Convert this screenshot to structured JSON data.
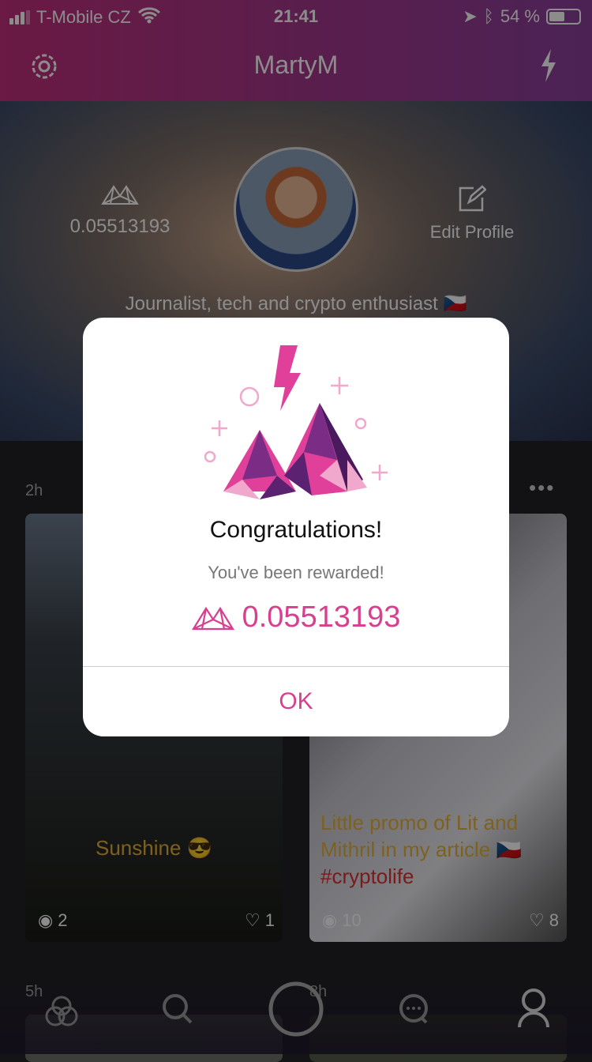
{
  "status_bar": {
    "carrier": "T-Mobile CZ",
    "time": "21:41",
    "battery": "54 %",
    "battery_level": 0.54
  },
  "header": {
    "title": "MartyM",
    "left_icon": "gear-icon",
    "right_icon": "lightning-icon"
  },
  "profile": {
    "balance": "0.05513193",
    "edit_label": "Edit Profile",
    "bio": "Journalist, tech and crypto enthusiast 🇨🇿"
  },
  "feed": {
    "posts": [
      {
        "time": "2h",
        "caption": "Sunshine 😎",
        "views": "2",
        "likes": "1"
      },
      {
        "caption": "Little promo of Lit and Mithril in my article 🇨🇿",
        "tag": "#cryptolife",
        "views": "10",
        "likes": "8"
      },
      {
        "time": "5h"
      },
      {
        "time": "8h"
      }
    ]
  },
  "tabbar": {
    "items": [
      "circles",
      "search",
      "capture",
      "messages",
      "profile"
    ]
  },
  "modal": {
    "title": "Congratulations!",
    "subtitle": "You've been rewarded!",
    "amount": "0.05513193",
    "ok_label": "OK",
    "accent": "#d83f8f"
  }
}
